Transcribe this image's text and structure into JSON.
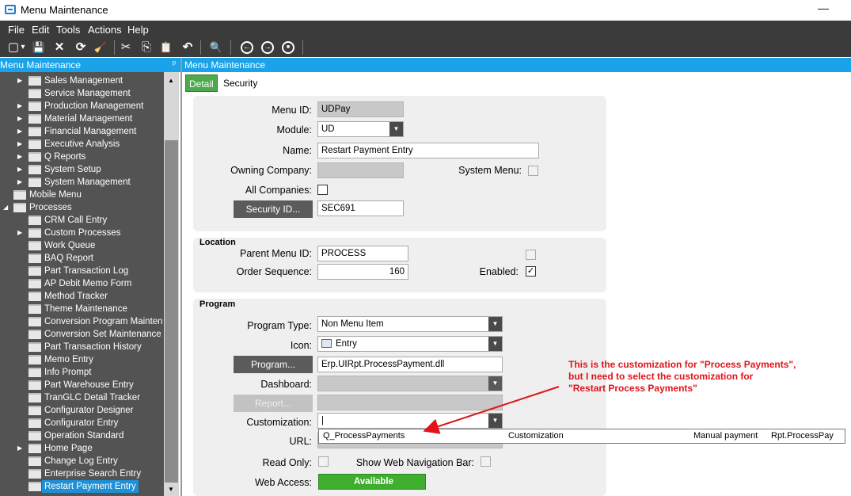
{
  "window": {
    "title": "Menu Maintenance",
    "min_symbol": "—"
  },
  "menubar": [
    "File",
    "Edit",
    "Tools",
    "Actions",
    "Help"
  ],
  "toolbar": {
    "new": "▢",
    "new_arrow": "▾",
    "save": "💾",
    "delete": "✕",
    "refresh": "⟳",
    "clear": "🧹",
    "cut": "✂",
    "copy": "⎘",
    "paste": "📋",
    "undo": "↶",
    "search": "🔍",
    "prev": "←",
    "next": "→",
    "stop": "■"
  },
  "left_panel": {
    "header": "Menu Maintenance",
    "pin": "ᵖ",
    "items": [
      {
        "label": "Sales Management",
        "expand": "▶"
      },
      {
        "label": "Service Management",
        "expand": ""
      },
      {
        "label": "Production Management",
        "expand": "▶"
      },
      {
        "label": "Material Management",
        "expand": "▶"
      },
      {
        "label": "Financial Management",
        "expand": "▶"
      },
      {
        "label": "Executive Analysis",
        "expand": "▶"
      },
      {
        "label": "Q Reports",
        "expand": "▶"
      },
      {
        "label": "System Setup",
        "expand": "▶"
      },
      {
        "label": "System Management",
        "expand": "▶"
      },
      {
        "label": "Mobile Menu",
        "expand": ""
      },
      {
        "label": "Processes",
        "expand": "◢"
      },
      {
        "label": "CRM Call Entry",
        "expand": ""
      },
      {
        "label": "Custom Processes",
        "expand": "▶"
      },
      {
        "label": "Work Queue",
        "expand": ""
      },
      {
        "label": "BAQ Report",
        "expand": ""
      },
      {
        "label": "Part Transaction Log",
        "expand": ""
      },
      {
        "label": "AP Debit Memo Form",
        "expand": ""
      },
      {
        "label": "Method Tracker",
        "expand": ""
      },
      {
        "label": "Theme Maintenance",
        "expand": ""
      },
      {
        "label": "Conversion Program Mainten",
        "expand": ""
      },
      {
        "label": "Conversion Set Maintenance",
        "expand": ""
      },
      {
        "label": "Part Transaction History",
        "expand": ""
      },
      {
        "label": "Memo Entry",
        "expand": ""
      },
      {
        "label": "Info Prompt",
        "expand": ""
      },
      {
        "label": "Part Warehouse Entry",
        "expand": ""
      },
      {
        "label": "TranGLC Detail Tracker",
        "expand": ""
      },
      {
        "label": "Configurator Designer",
        "expand": ""
      },
      {
        "label": "Configurator Entry",
        "expand": ""
      },
      {
        "label": "Operation Standard",
        "expand": ""
      },
      {
        "label": "Home Page",
        "expand": "▶"
      },
      {
        "label": "Change Log Entry",
        "expand": ""
      },
      {
        "label": "Enterprise Search Entry",
        "expand": ""
      },
      {
        "label": "Restart Payment Entry",
        "expand": ""
      }
    ],
    "scroll_up": "▲",
    "scroll_down": "▼"
  },
  "right_panel": {
    "header": "Menu Maintenance",
    "tabs": [
      "Detail",
      "Security"
    ]
  },
  "detail": {
    "menu_id_label": "Menu ID:",
    "menu_id": "UDPay",
    "module_label": "Module:",
    "module": "UD",
    "name_label": "Name:",
    "name": "Restart Payment Entry",
    "owning_company_label": "Owning Company:",
    "owning_company": "",
    "system_menu_label": "System Menu:",
    "all_companies_label": "All Companies:",
    "security_button": "Security ID...",
    "security_id": "SEC691"
  },
  "location": {
    "section": "Location",
    "parent_label": "Parent Menu ID:",
    "parent": "PROCESS",
    "order_label": "Order Sequence:",
    "order": "160",
    "enabled_label": "Enabled:",
    "enabled_mark": "✓"
  },
  "program": {
    "section": "Program",
    "type_label": "Program Type:",
    "type": "Non Menu Item",
    "icon_label": "Icon:",
    "icon": "Entry",
    "program_button": "Program...",
    "program": "Erp.UIRpt.ProcessPayment.dll",
    "dashboard_label": "Dashboard:",
    "dashboard": "",
    "report_button": "Report...",
    "report": "",
    "customization_label": "Customization:",
    "customization": "|",
    "url_label": "URL:",
    "readonly_label": "Read Only:",
    "webnav_label": "Show Web Navigation Bar:",
    "webaccess_label": "Web Access:",
    "webaccess": "Available",
    "dropdown_arrow": "▼"
  },
  "dropdown_list": {
    "name": "Q_ProcessPayments",
    "type": "Customization",
    "description": "Manual payment",
    "form": "Rpt.ProcessPay"
  },
  "annotation": {
    "line1": "This is the customization for \"Process Payments\",",
    "line2": "but I need to select the customization for",
    "line3": "\"Restart Process Payments\"",
    "color": "#e0141a"
  }
}
